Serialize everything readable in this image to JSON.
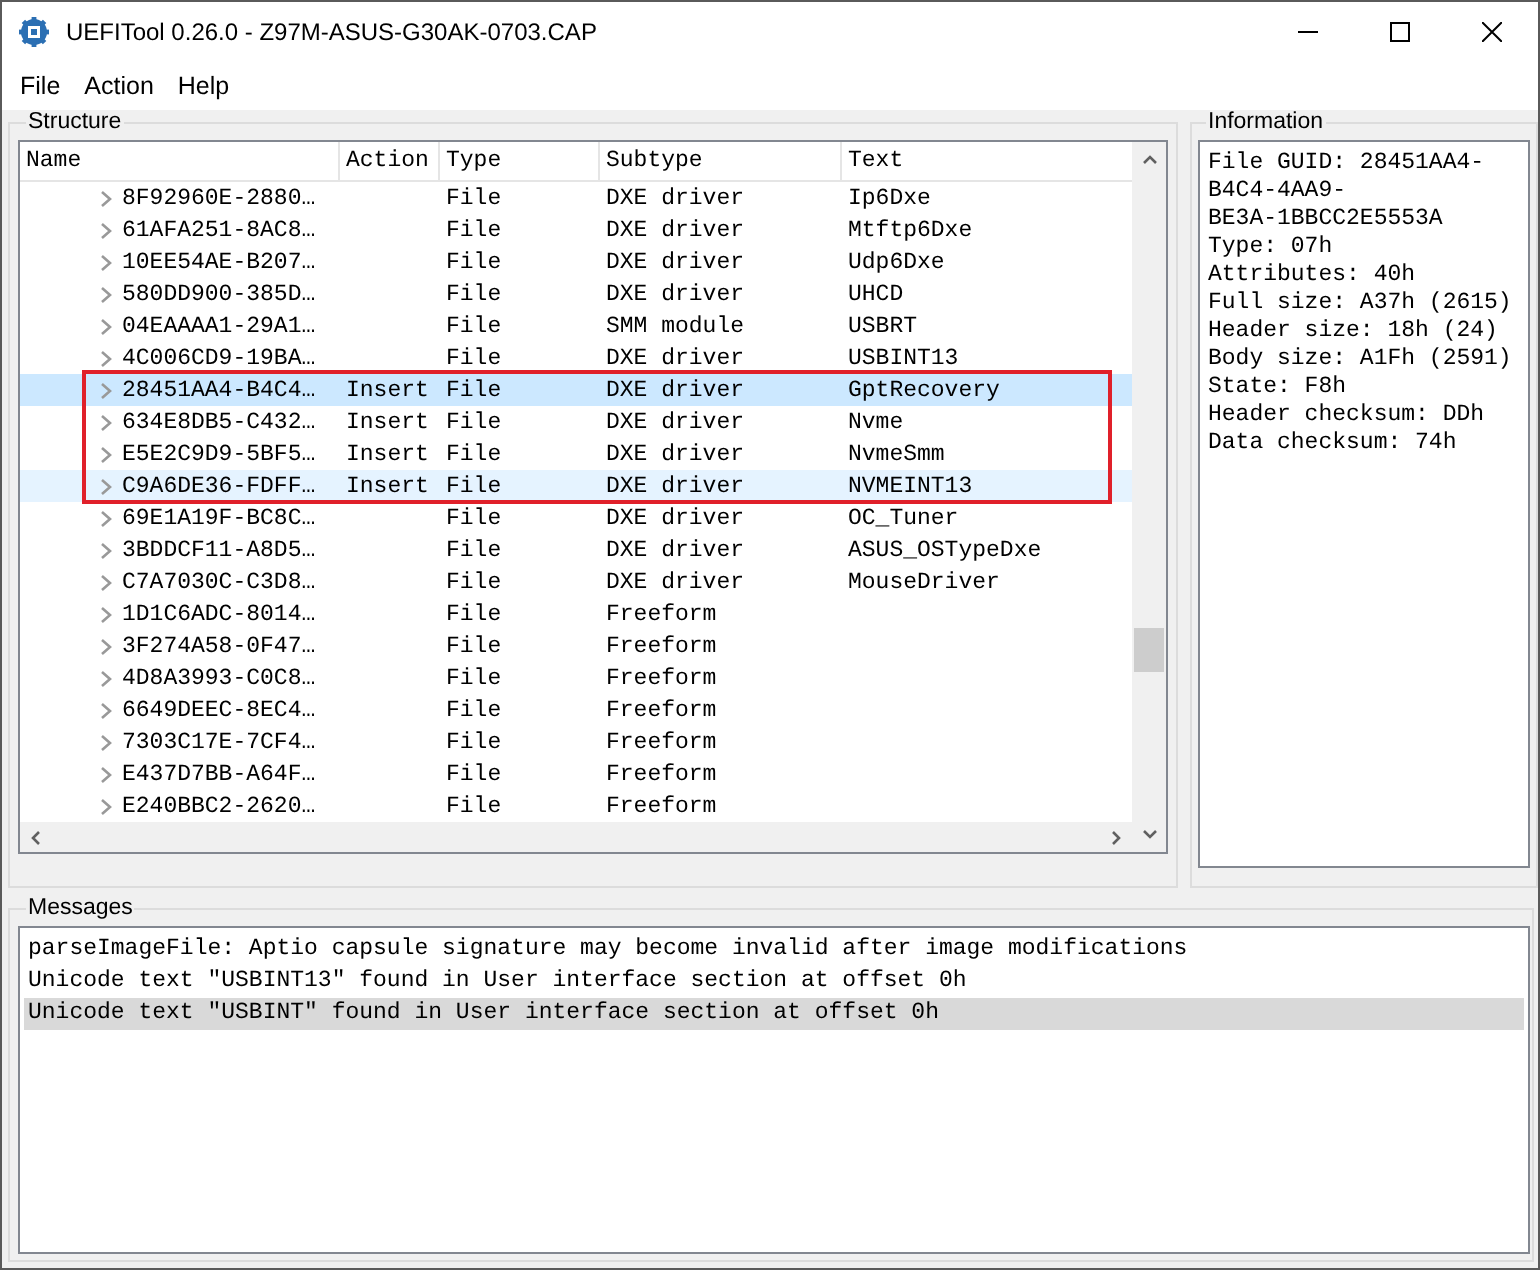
{
  "window": {
    "title": "UEFITool 0.26.0 - Z97M-ASUS-G30AK-0703.CAP"
  },
  "menu": [
    "File",
    "Action",
    "Help"
  ],
  "structure": {
    "title": "Structure",
    "columns": [
      "Name",
      "Action",
      "Type",
      "Subtype",
      "Text"
    ],
    "rows": [
      {
        "name": "8F92960E-2880…",
        "action": "",
        "type": "File",
        "subtype": "DXE driver",
        "text": "Ip6Dxe",
        "selected": false,
        "hovered": false,
        "boxed": false
      },
      {
        "name": "61AFA251-8AC8…",
        "action": "",
        "type": "File",
        "subtype": "DXE driver",
        "text": "Mtftp6Dxe",
        "selected": false,
        "hovered": false,
        "boxed": false
      },
      {
        "name": "10EE54AE-B207…",
        "action": "",
        "type": "File",
        "subtype": "DXE driver",
        "text": "Udp6Dxe",
        "selected": false,
        "hovered": false,
        "boxed": false
      },
      {
        "name": "580DD900-385D…",
        "action": "",
        "type": "File",
        "subtype": "DXE driver",
        "text": "UHCD",
        "selected": false,
        "hovered": false,
        "boxed": false
      },
      {
        "name": "04EAAAA1-29A1…",
        "action": "",
        "type": "File",
        "subtype": "SMM module",
        "text": "USBRT",
        "selected": false,
        "hovered": false,
        "boxed": false
      },
      {
        "name": "4C006CD9-19BA…",
        "action": "",
        "type": "File",
        "subtype": "DXE driver",
        "text": "USBINT13",
        "selected": false,
        "hovered": false,
        "boxed": false
      },
      {
        "name": "28451AA4-B4C4…",
        "action": "Insert",
        "type": "File",
        "subtype": "DXE driver",
        "text": "GptRecovery",
        "selected": true,
        "hovered": false,
        "boxed": true
      },
      {
        "name": "634E8DB5-C432…",
        "action": "Insert",
        "type": "File",
        "subtype": "DXE driver",
        "text": "Nvme",
        "selected": false,
        "hovered": false,
        "boxed": true
      },
      {
        "name": "E5E2C9D9-5BF5…",
        "action": "Insert",
        "type": "File",
        "subtype": "DXE driver",
        "text": "NvmeSmm",
        "selected": false,
        "hovered": false,
        "boxed": true
      },
      {
        "name": "C9A6DE36-FDFF…",
        "action": "Insert",
        "type": "File",
        "subtype": "DXE driver",
        "text": "NVMEINT13",
        "selected": false,
        "hovered": true,
        "boxed": true
      },
      {
        "name": "69E1A19F-BC8C…",
        "action": "",
        "type": "File",
        "subtype": "DXE driver",
        "text": "OC_Tuner",
        "selected": false,
        "hovered": false,
        "boxed": false
      },
      {
        "name": "3BDDCF11-A8D5…",
        "action": "",
        "type": "File",
        "subtype": "DXE driver",
        "text": "ASUS_OSTypeDxe",
        "selected": false,
        "hovered": false,
        "boxed": false
      },
      {
        "name": "C7A7030C-C3D8…",
        "action": "",
        "type": "File",
        "subtype": "DXE driver",
        "text": "MouseDriver",
        "selected": false,
        "hovered": false,
        "boxed": false
      },
      {
        "name": "1D1C6ADC-8014…",
        "action": "",
        "type": "File",
        "subtype": "Freeform",
        "text": "",
        "selected": false,
        "hovered": false,
        "boxed": false
      },
      {
        "name": "3F274A58-0F47…",
        "action": "",
        "type": "File",
        "subtype": "Freeform",
        "text": "",
        "selected": false,
        "hovered": false,
        "boxed": false
      },
      {
        "name": "4D8A3993-C0C8…",
        "action": "",
        "type": "File",
        "subtype": "Freeform",
        "text": "",
        "selected": false,
        "hovered": false,
        "boxed": false
      },
      {
        "name": "6649DEEC-8EC4…",
        "action": "",
        "type": "File",
        "subtype": "Freeform",
        "text": "",
        "selected": false,
        "hovered": false,
        "boxed": false
      },
      {
        "name": "7303C17E-7CF4…",
        "action": "",
        "type": "File",
        "subtype": "Freeform",
        "text": "",
        "selected": false,
        "hovered": false,
        "boxed": false
      },
      {
        "name": "E437D7BB-A64F…",
        "action": "",
        "type": "File",
        "subtype": "Freeform",
        "text": "",
        "selected": false,
        "hovered": false,
        "boxed": false
      },
      {
        "name": "E240BBC2-2620…",
        "action": "",
        "type": "File",
        "subtype": "Freeform",
        "text": "",
        "selected": false,
        "hovered": false,
        "boxed": false
      }
    ]
  },
  "information": {
    "title": "Information",
    "lines": [
      "File GUID: 28451AA4-",
      "B4C4-4AA9-",
      "BE3A-1BBCC2E5553A",
      "Type: 07h",
      "Attributes: 40h",
      "Full size: A37h (2615)",
      "Header size: 18h (24)",
      "Body size: A1Fh (2591)",
      "State: F8h",
      "Header checksum: DDh",
      "Data checksum: 74h"
    ]
  },
  "messages": {
    "title": "Messages",
    "items": [
      {
        "text": "parseImageFile: Aptio capsule signature may become invalid after image modifications",
        "selected": false
      },
      {
        "text": "Unicode text \"USBINT13\" found in User interface section at offset 0h",
        "selected": false
      },
      {
        "text": "Unicode text \"USBINT\" found in User interface section at offset 0h",
        "selected": true
      }
    ]
  }
}
